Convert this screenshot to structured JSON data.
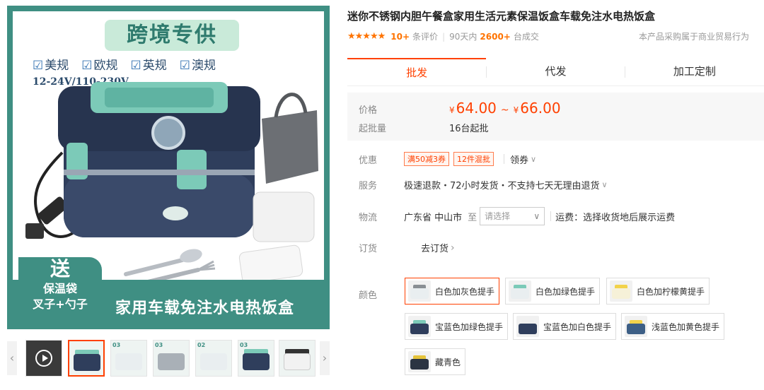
{
  "gallery": {
    "banner": "跨境专供",
    "plugs": [
      "美规",
      "欧规",
      "英规",
      "澳规"
    ],
    "checkbox_glyph": "☑",
    "voltage": "12-24V/110-230V",
    "gift_line1": "送",
    "gift_line2": "保温袋",
    "gift_line3": "叉子+勺子",
    "bottom_title": "家用车载免注水电热饭盒",
    "thumb_labels": [
      "03",
      "03",
      "02",
      "03"
    ]
  },
  "product": {
    "title": "迷你不锈钢内胆午餐盒家用生活元素保温饭盒车载免注水电热饭盒",
    "stars": "★★★★★",
    "review_count": "10+",
    "review_label": "条评价",
    "period_label": "90天内",
    "sold_count": "2600+",
    "sold_label": "台成交",
    "purchase_note": "本产品采购属于商业贸易行为"
  },
  "tabs": [
    "批发",
    "代发",
    "加工定制"
  ],
  "price": {
    "label": "价格",
    "currency": "¥",
    "low": "64.00",
    "tilde": "~",
    "high": "66.00",
    "moq_label": "起批量",
    "moq_value": "16台起批"
  },
  "promo": {
    "label": "优惠",
    "coupons": [
      "满50减3券",
      "12件混批"
    ],
    "get_coupon": "领券"
  },
  "service": {
    "label": "服务",
    "text": "极速退款・72小时发货・不支持七天无理由退货"
  },
  "logistics": {
    "label": "物流",
    "origin": "广东省 中山市",
    "to": "至",
    "placeholder": "请选择",
    "fee": "运费：选择收货地后展示运费"
  },
  "order": {
    "label": "订货",
    "link": "去订货",
    "arrow": "›"
  },
  "color": {
    "label": "颜色",
    "options": [
      {
        "name": "白色加灰色提手",
        "body": "#e9eef0",
        "handle": "#8a8f94"
      },
      {
        "name": "白色加绿色提手",
        "body": "#e9eef0",
        "handle": "#7ccab8"
      },
      {
        "name": "白色加柠檬黄提手",
        "body": "#f6f1d8",
        "handle": "#f2d24b"
      },
      {
        "name": "宝蓝色加绿色提手",
        "body": "#2f3e5c",
        "handle": "#7ccab8"
      },
      {
        "name": "宝蓝色加白色提手",
        "body": "#2f3e5c",
        "handle": "#eeeeee"
      },
      {
        "name": "浅蓝色加黄色提手",
        "body": "#3d5f86",
        "handle": "#f2d24b"
      },
      {
        "name": "藏青色",
        "body": "#2b3442",
        "handle": "#e5c33a"
      }
    ]
  },
  "accent": "#ff4000",
  "brand_teal": "#3f8f83"
}
